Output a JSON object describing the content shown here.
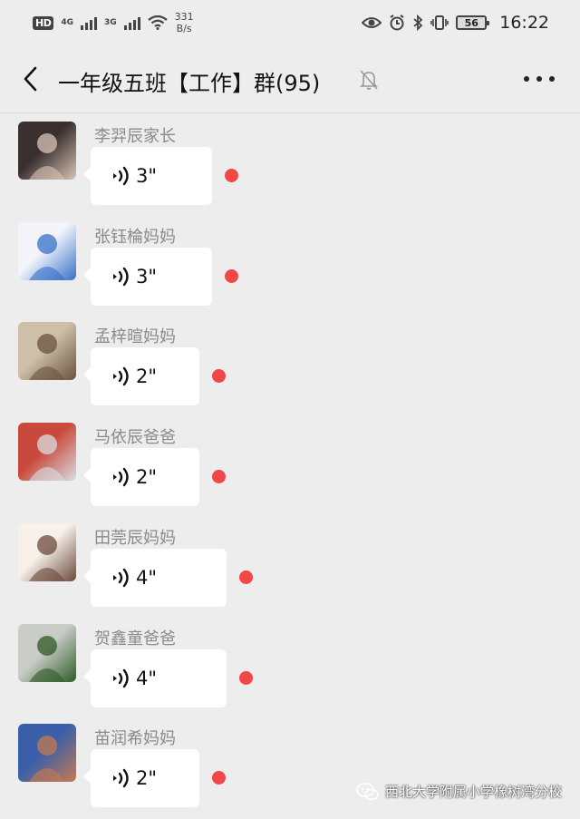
{
  "status_bar": {
    "hd": "HD",
    "net1": "4G",
    "net2": "3G",
    "speed_value": "331",
    "speed_unit": "B/s",
    "battery": "56",
    "time": "16:22"
  },
  "header": {
    "title": "一年级五班【工作】群(95)"
  },
  "messages": [
    {
      "sender": "李羿辰家长",
      "duration": "3\"",
      "bubble_w": 134,
      "avatar_colors": [
        "#3a3030",
        "#d9c3b5"
      ]
    },
    {
      "sender": "张钰棆妈妈",
      "duration": "3\"",
      "bubble_w": 134,
      "avatar_colors": [
        "#f2f4fa",
        "#3570c8"
      ]
    },
    {
      "sender": "孟梓暄妈妈",
      "duration": "2\"",
      "bubble_w": 120,
      "avatar_colors": [
        "#cdbfa8",
        "#6a5240"
      ]
    },
    {
      "sender": "马依辰爸爸",
      "duration": "2\"",
      "bubble_w": 120,
      "avatar_colors": [
        "#c94a3c",
        "#d8dde2"
      ]
    },
    {
      "sender": "田莞辰妈妈",
      "duration": "4\"",
      "bubble_w": 150,
      "avatar_colors": [
        "#f7f1ea",
        "#6a4a3a"
      ]
    },
    {
      "sender": "贺鑫童爸爸",
      "duration": "4\"",
      "bubble_w": 150,
      "avatar_colors": [
        "#c9ccc7",
        "#2f5a26"
      ]
    },
    {
      "sender": "苗润希妈妈",
      "duration": "2\"",
      "bubble_w": 120,
      "avatar_colors": [
        "#3a5fa8",
        "#c47a52"
      ]
    }
  ],
  "watermark": "西北大学附属小学橡树湾分校",
  "colors": {
    "background": "#ededed",
    "bubble": "#ffffff",
    "unread": "#f04848"
  }
}
